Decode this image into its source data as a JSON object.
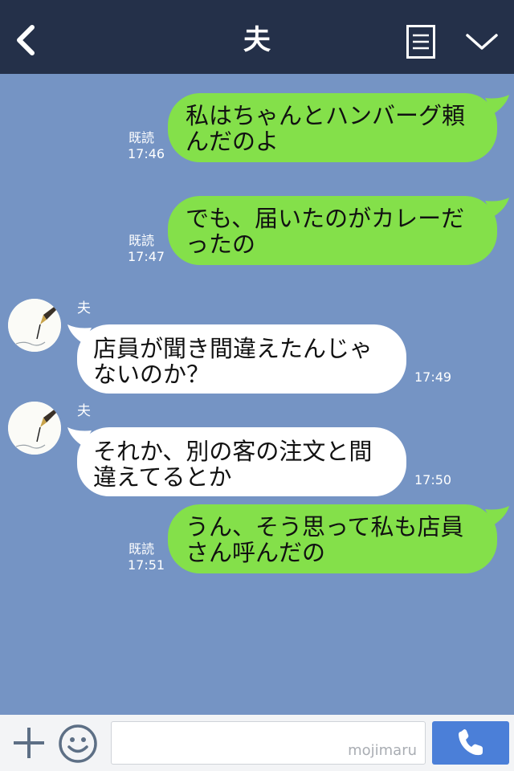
{
  "header": {
    "title": "夫"
  },
  "chat": {
    "outgoing": [
      {
        "read_label": "既読",
        "time": "17:46",
        "text": "私はちゃんとハンバーグ頼\nんだのよ"
      },
      {
        "read_label": "既読",
        "time": "17:47",
        "text": "でも、届いたのがカレーだ\nったの"
      },
      {
        "read_label": "既読",
        "time": "17:51",
        "text": "うん、そう思って私も店員\nさん呼んだの"
      }
    ],
    "incoming": [
      {
        "sender": "夫",
        "time": "17:49",
        "text": "店員が聞き間違えたんじゃ\nないのか？"
      },
      {
        "sender": "夫",
        "time": "17:50",
        "text": "それか、別の客の注文と間\n違えてるとか"
      }
    ]
  },
  "footer": {
    "input_value": "",
    "watermark": "mojimaru"
  },
  "colors": {
    "header_bg": "#243049",
    "chat_bg": "#7594c4",
    "outgoing_bubble": "#84e04a",
    "incoming_bubble": "#ffffff",
    "call_button": "#4b7fd8"
  },
  "icons": [
    "back-icon",
    "menu-icon",
    "chevron-down-icon",
    "plus-icon",
    "emoji-icon",
    "phone-icon"
  ]
}
